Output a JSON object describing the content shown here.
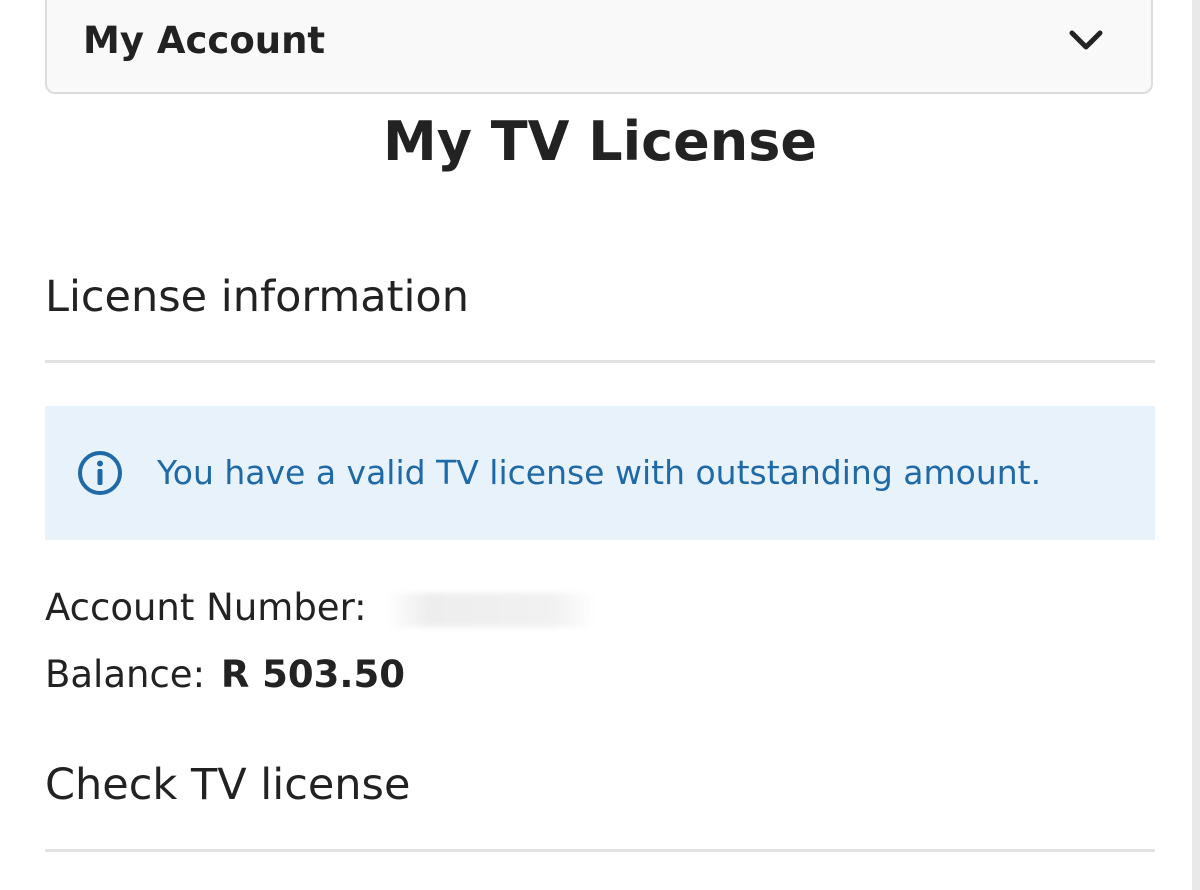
{
  "account_menu": {
    "label": "My Account",
    "icon": "chevron-down-icon"
  },
  "page": {
    "title": "My TV License"
  },
  "license_section": {
    "heading": "License information",
    "notice": {
      "icon": "info-icon",
      "text": "You have a valid TV license with outstanding amount.",
      "text_color": "#1f6aa6",
      "background": "#e7f2fb"
    },
    "account_number_label": "Account Number:",
    "balance_label": "Balance:",
    "balance_value": "R 503.50"
  },
  "check_section": {
    "heading": "Check TV license"
  }
}
